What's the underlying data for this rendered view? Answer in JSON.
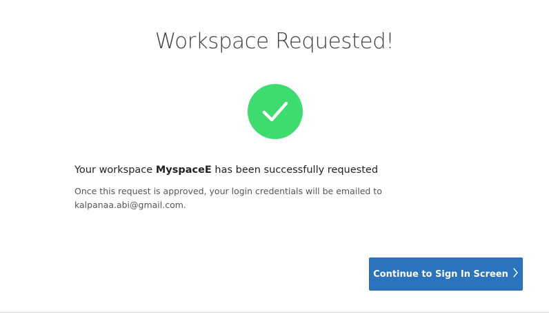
{
  "dialog": {
    "title": "Workspace Requested!",
    "message_prefix": "Your workspace ",
    "workspace_name": "MyspaceE",
    "message_suffix": " has been successfully requested",
    "note_line1": "Once this request is approved, your login credentials will be emailed to",
    "note_line2": "kalpanaa.abi@gmail.com.",
    "continue_label": "Continue to Sign In Screen",
    "icons": {
      "success": "check-icon",
      "continue": "chevron-right-icon"
    },
    "colors": {
      "success": "#3ddc6e",
      "button": "#2a73bd",
      "button_text": "#ffffff"
    }
  }
}
